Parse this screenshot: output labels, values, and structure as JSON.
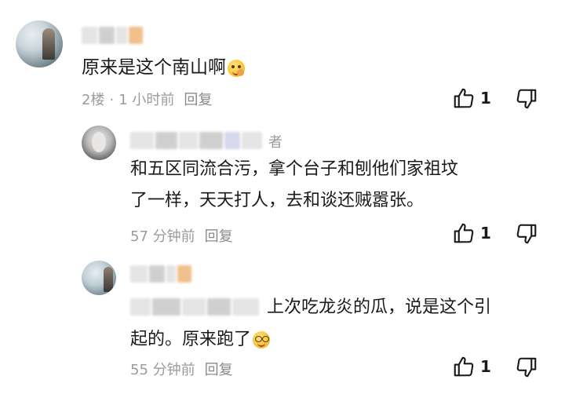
{
  "comments": [
    {
      "text": "原来是这个南山啊",
      "floor": "2楼",
      "separator": "·",
      "time": "1 小时前",
      "reply_label": "回复",
      "likes": "1",
      "emoji_icon": "laughing-face-emoji"
    },
    {
      "author_tag": "者",
      "text_lines": [
        "和五区同流合污，拿个台子和刨他们家祖坟",
        "了一样，天天打人，去和谈还贼嚣张。"
      ],
      "time": "57 分钟前",
      "reply_label": "回复",
      "likes": "1"
    },
    {
      "text_lines": [
        "上次吃龙炎的瓜，说是这个引",
        "起的。原来跑了"
      ],
      "time": "55 分钟前",
      "reply_label": "回复",
      "likes": "1",
      "emoji_icon": "glasses-face-emoji"
    }
  ]
}
